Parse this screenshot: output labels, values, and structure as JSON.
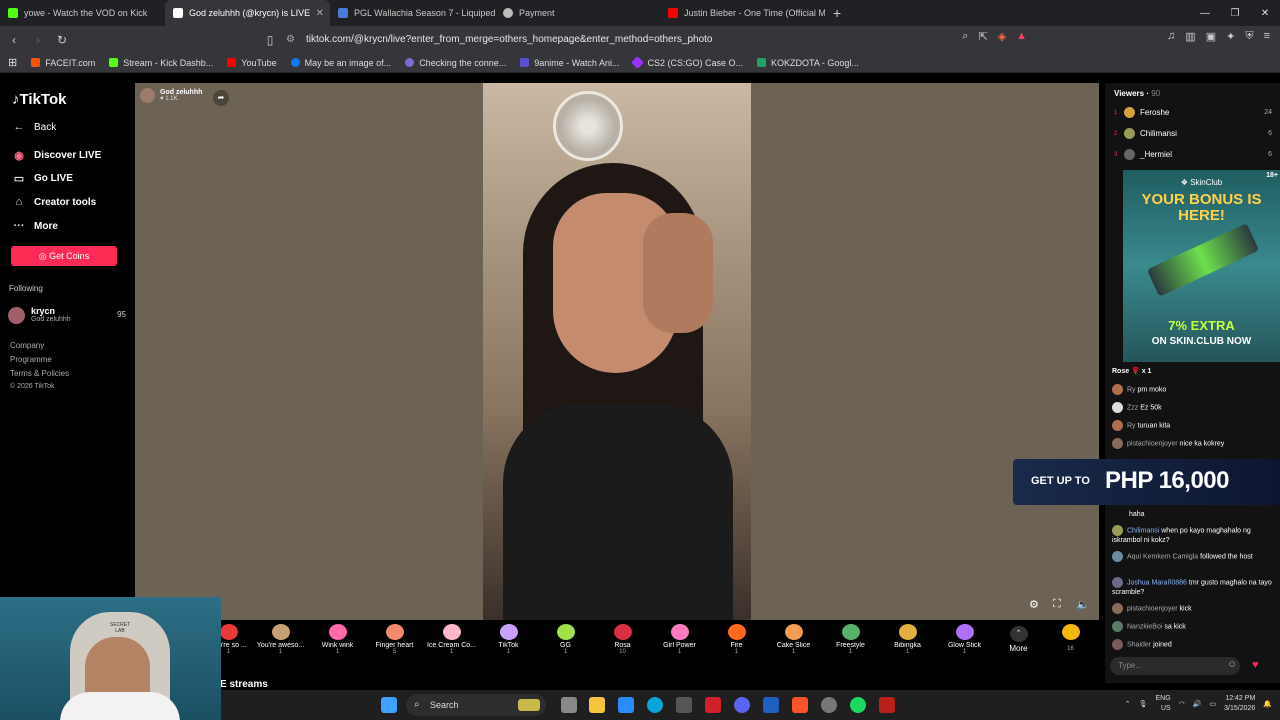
{
  "browser": {
    "tabs": [
      {
        "label": "yowe - Watch the VOD on Kick",
        "color": "#53fc18"
      },
      {
        "label": "God zeluhhh (@krycn) is LIVE",
        "color": "#ffffff",
        "active": true
      },
      {
        "label": "PGL Wallachia Season 7 - Liquipedia",
        "color": "#4a7bd8"
      },
      {
        "label": "Payment",
        "color": "#bbbbbb"
      },
      {
        "label": "Justin Bieber - One Time (Official Mu...",
        "color": "#ff0000"
      }
    ],
    "url": "tiktok.com/@krycn/live?enter_from_merge=others_homepage&enter_method=others_photo",
    "bookmarks": [
      {
        "label": "FACEIT.com",
        "color": "#ff5500"
      },
      {
        "label": "Stream - Kick Dashb...",
        "color": "#53fc18"
      },
      {
        "label": "YouTube",
        "color": "#ff0000"
      },
      {
        "label": "May be an image of...",
        "color": "#1877f2"
      },
      {
        "label": "Checking the conne...",
        "color": "#7c6cd6"
      },
      {
        "label": "9anime - Watch Ani...",
        "color": "#5a4fcf"
      },
      {
        "label": "CS2 (CS:GO) Case O...",
        "color": "#9b30ff"
      },
      {
        "label": "KOKZDOTA - Googl...",
        "color": "#21a366"
      }
    ]
  },
  "leftnav": {
    "logo": "TikTok",
    "items": [
      {
        "label": "Back",
        "icon": "←"
      },
      {
        "label": "Discover LIVE",
        "icon": "◉"
      },
      {
        "label": "Go LIVE",
        "icon": "▭"
      },
      {
        "label": "Creator tools",
        "icon": "⌂"
      },
      {
        "label": "More",
        "icon": "···"
      }
    ],
    "coins_label": "Get Coins",
    "following_header": "Following",
    "following": {
      "name": "krycn",
      "sub": "God zeluhhh",
      "count": "95"
    },
    "footer": [
      "Company",
      "Programme",
      "Terms & Policies",
      "© 2026 TikTok"
    ]
  },
  "stage": {
    "host_name": "God zeluhhh",
    "host_likes": "1.1K"
  },
  "gifts": [
    {
      "name": "You're so ...",
      "price": "1",
      "color": "#e83a3a"
    },
    {
      "name": "You're aweso...",
      "price": "1",
      "color": "#c8a078"
    },
    {
      "name": "Wink wink",
      "price": "1",
      "color": "#ff6aa8"
    },
    {
      "name": "Finger heart",
      "price": "5",
      "color": "#f08c6c"
    },
    {
      "name": "Ice Cream Co...",
      "price": "1",
      "color": "#ffb6c9"
    },
    {
      "name": "TikTok",
      "price": "1",
      "color": "#c9a0ff"
    },
    {
      "name": "GG",
      "price": "1",
      "color": "#a0e04a"
    },
    {
      "name": "Rosa",
      "price": "10",
      "color": "#d83040"
    },
    {
      "name": "Girl Power",
      "price": "1",
      "color": "#ff7bc0"
    },
    {
      "name": "Fire",
      "price": "1",
      "color": "#ff6a1a"
    },
    {
      "name": "Cake Slice",
      "price": "1",
      "color": "#f0a050"
    },
    {
      "name": "Freestyle",
      "price": "1",
      "color": "#5ab06a"
    },
    {
      "name": "Bibingka",
      "price": "1",
      "color": "#e0b040"
    },
    {
      "name": "Glow Stick",
      "price": "1",
      "color": "#b070ff"
    }
  ],
  "gifts_more": "More",
  "coins_count": "16",
  "streams_label": "E streams",
  "viewers": {
    "header": "Viewers",
    "count": "90",
    "list": [
      {
        "rank": "1",
        "name": "Feroshe",
        "count": "24",
        "color": "#d4a13c"
      },
      {
        "rank": "2",
        "name": "Chilimansi",
        "count": "6",
        "color": "#9a9a5a"
      },
      {
        "rank": "3",
        "name": "_Hermiel",
        "count": "6",
        "color": "#666666"
      }
    ]
  },
  "ad": {
    "age": "18+",
    "brand": "SkinClub",
    "headline": "YOUR BONUS IS HERE!",
    "extra": "7% EXTRA",
    "cta": "ON SKIN.CLUB NOW"
  },
  "chat": [
    {
      "user": "",
      "text": "Rose 🌹 x 1",
      "color": "#ff5a7a"
    },
    {
      "user": "Ry",
      "text": "pm moko",
      "color": "#b07050"
    },
    {
      "user": "Zzz",
      "text": "Ez 50k",
      "color": "#dddddd"
    },
    {
      "user": "Ry",
      "text": "turuan kita",
      "color": "#b07050"
    },
    {
      "user": "pistachioenjoyer",
      "text": "nice ka kokrey",
      "color": "#8a6a5a"
    },
    {
      "user": "",
      "text": "haha",
      "color": "#555555"
    },
    {
      "user": "Chilimansi",
      "text": "when po kayo maghahalo ng iskrambol ni kokz?",
      "color": "#9a9a5a"
    },
    {
      "user": "Aqui Kemkem Camigla",
      "text": "followed the host",
      "color": "#6a8aa0"
    },
    {
      "user": "Joshua Marañ0886",
      "text": "tmr gusto maghalo na tayo scramble?",
      "color": "#6a6a8a"
    },
    {
      "user": "pistachioenjoyer",
      "text": "kick",
      "color": "#8a6a5a"
    },
    {
      "user": "NanzkieBoi",
      "text": "sa kick",
      "color": "#5a7a6a"
    },
    {
      "user": "Shaider",
      "text": "joined",
      "color": "#7a5a5a"
    }
  ],
  "banner": {
    "prefix": "GET UP TO",
    "amount": "PHP 16,000"
  },
  "chat_placeholder": "Type...",
  "taskbar": {
    "search": "Search",
    "lang": "ENG",
    "region": "US",
    "time": "12:42 PM",
    "date": "3/15/2026"
  },
  "cam": {
    "chair_brand": "SECRET LAB"
  }
}
